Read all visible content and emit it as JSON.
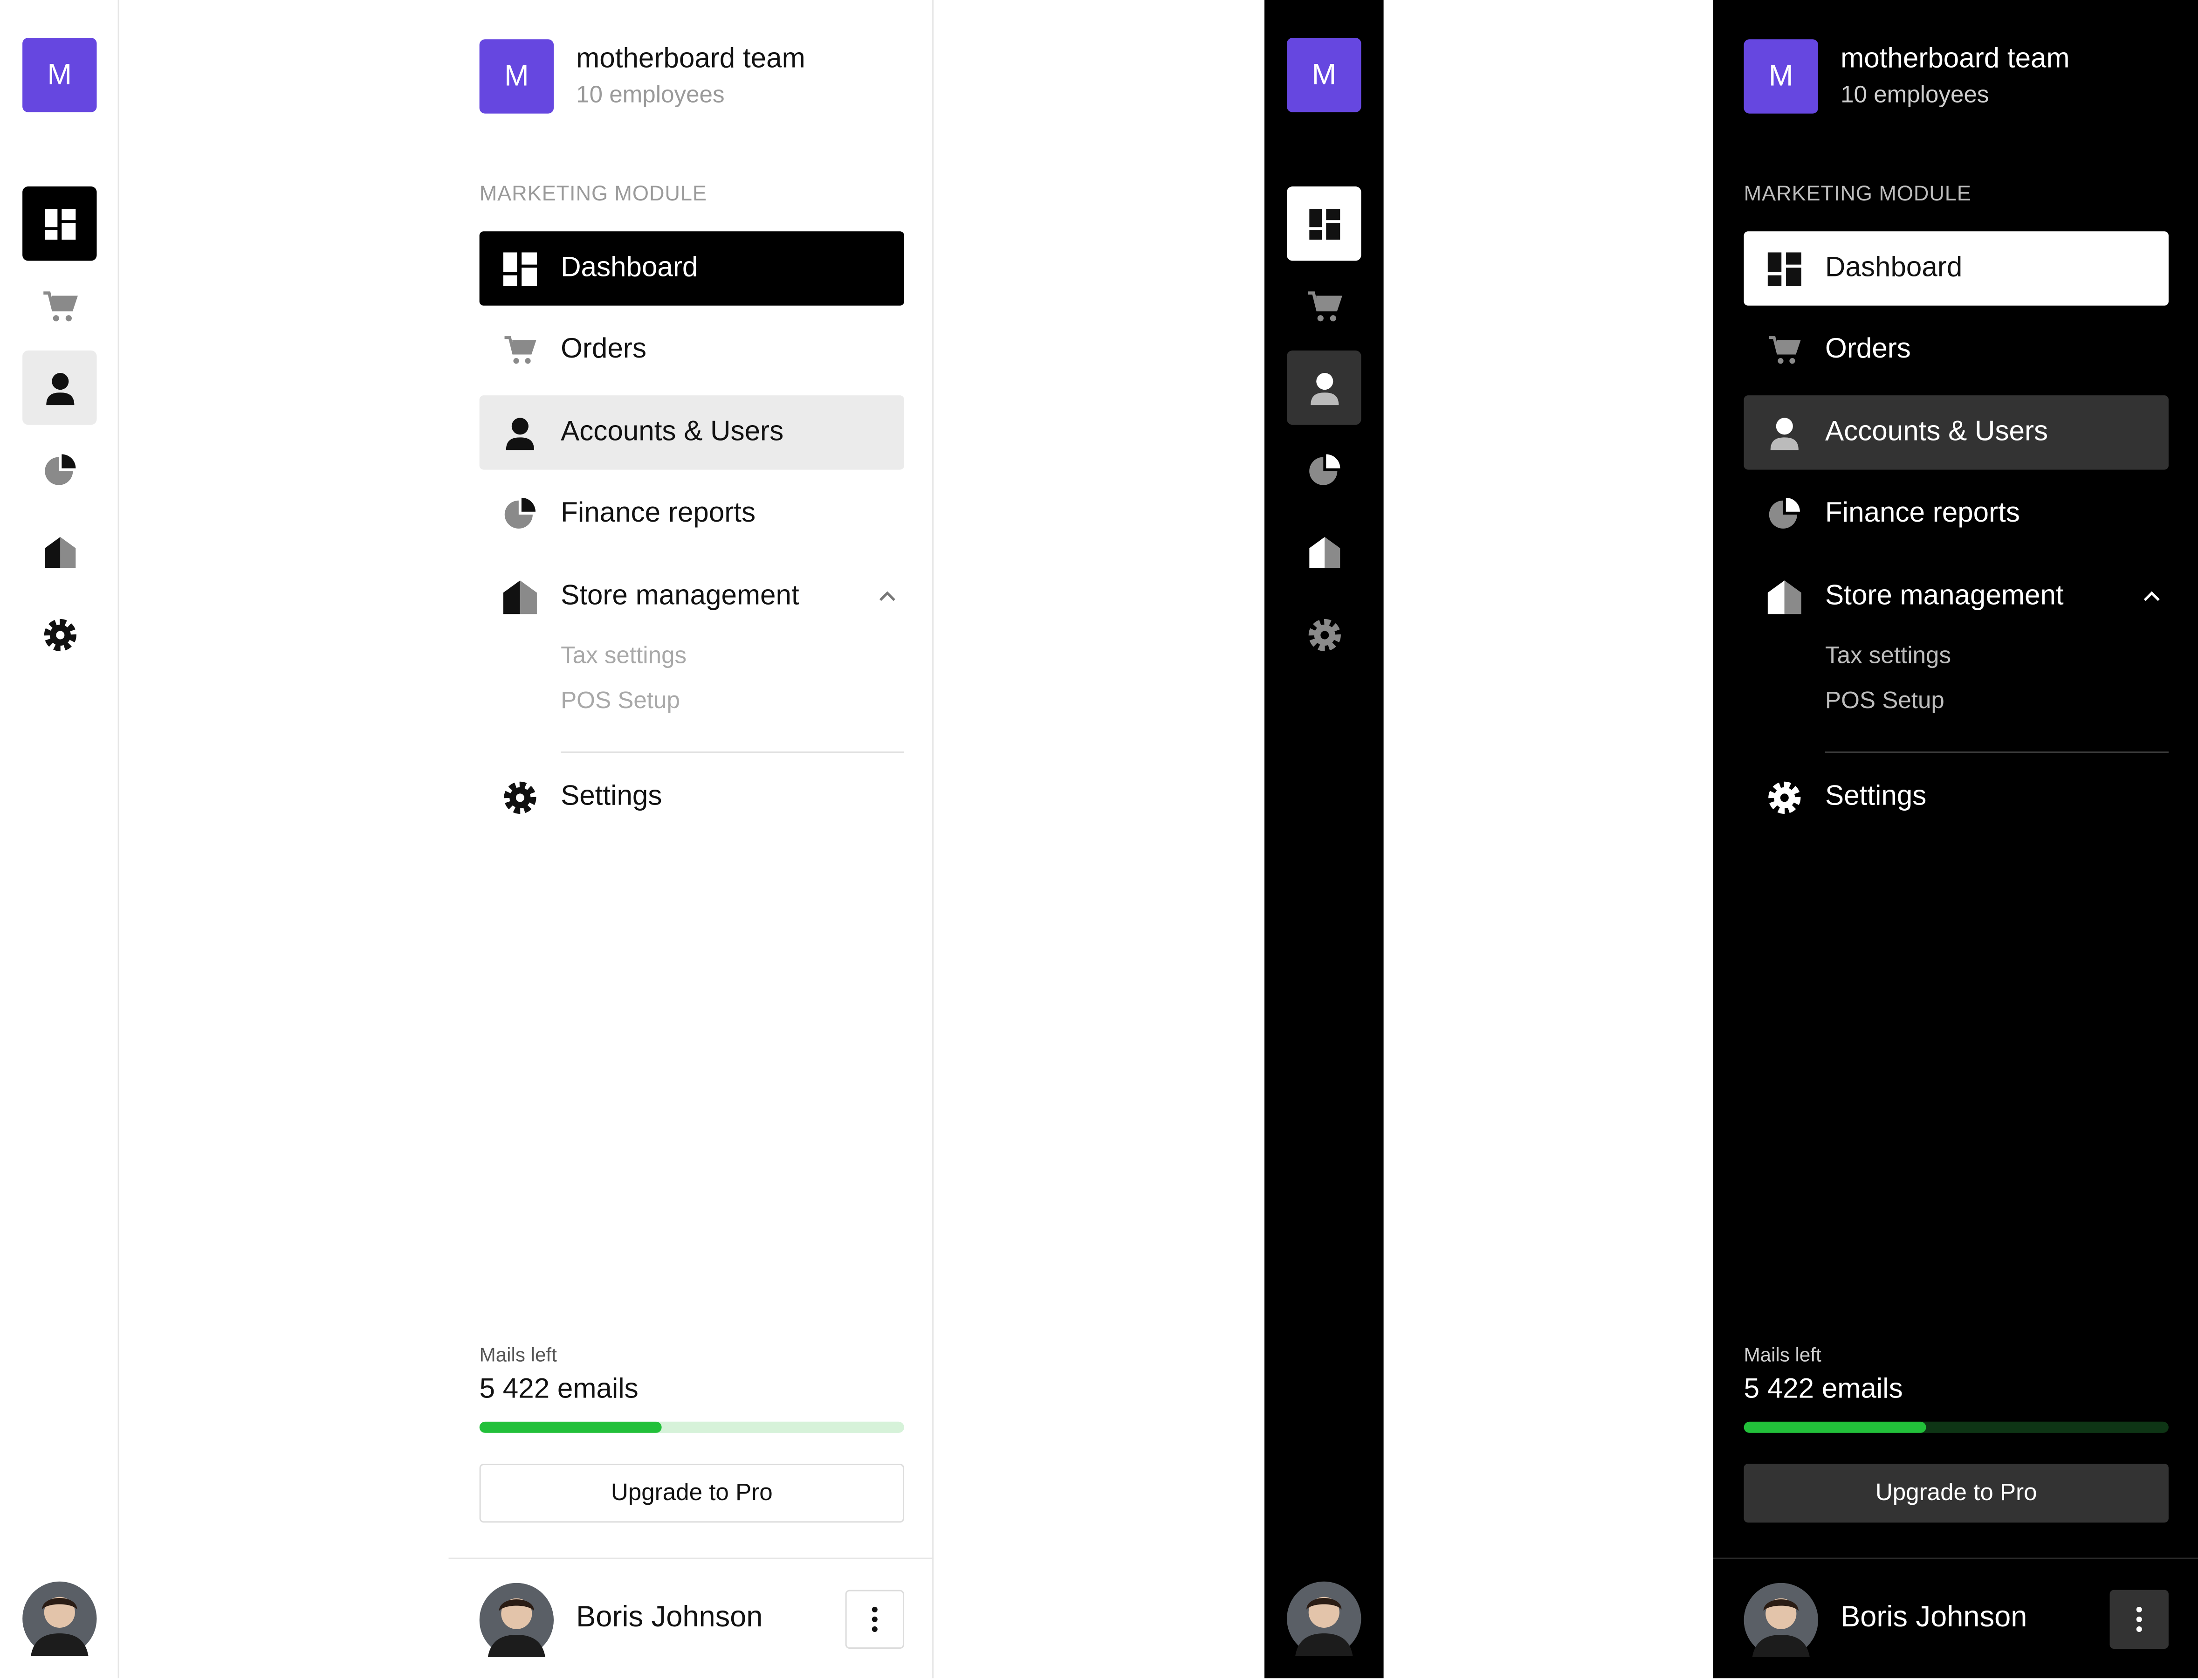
{
  "colors": {
    "brand": "#6647e0",
    "progress_fill": "#22c03a",
    "progress_track_light": "#d6f2d9",
    "progress_track_dark": "#0e3515",
    "active_light_bg": "#000000",
    "active_dark_bg": "#ffffff",
    "hover_light_bg": "#ebebeb",
    "hover_dark_bg": "#333333"
  },
  "team": {
    "initial": "M",
    "name": "motherboard team",
    "subtitle": "10 employees"
  },
  "section_label": "MARKETING MODULE",
  "nav": {
    "dashboard": {
      "label": "Dashboard",
      "icon": "dashboard-grid-icon",
      "state": "active"
    },
    "orders": {
      "label": "Orders",
      "icon": "cart-icon"
    },
    "accounts": {
      "label": "Accounts & Users",
      "icon": "user-icon",
      "state": "hover"
    },
    "finance": {
      "label": "Finance reports",
      "icon": "pie-chart-icon"
    },
    "store": {
      "label": "Store management",
      "icon": "store-icon",
      "expanded": true
    },
    "settings": {
      "label": "Settings",
      "icon": "gear-icon"
    }
  },
  "store_sub": {
    "tax": "Tax settings",
    "pos": "POS Setup"
  },
  "mails": {
    "label": "Mails left",
    "value": "5 422 emails",
    "progress_fraction": 0.43
  },
  "upgrade_label": "Upgrade to Pro",
  "user": {
    "name": "Boris Johnson",
    "avatar": "user-avatar-photo"
  }
}
